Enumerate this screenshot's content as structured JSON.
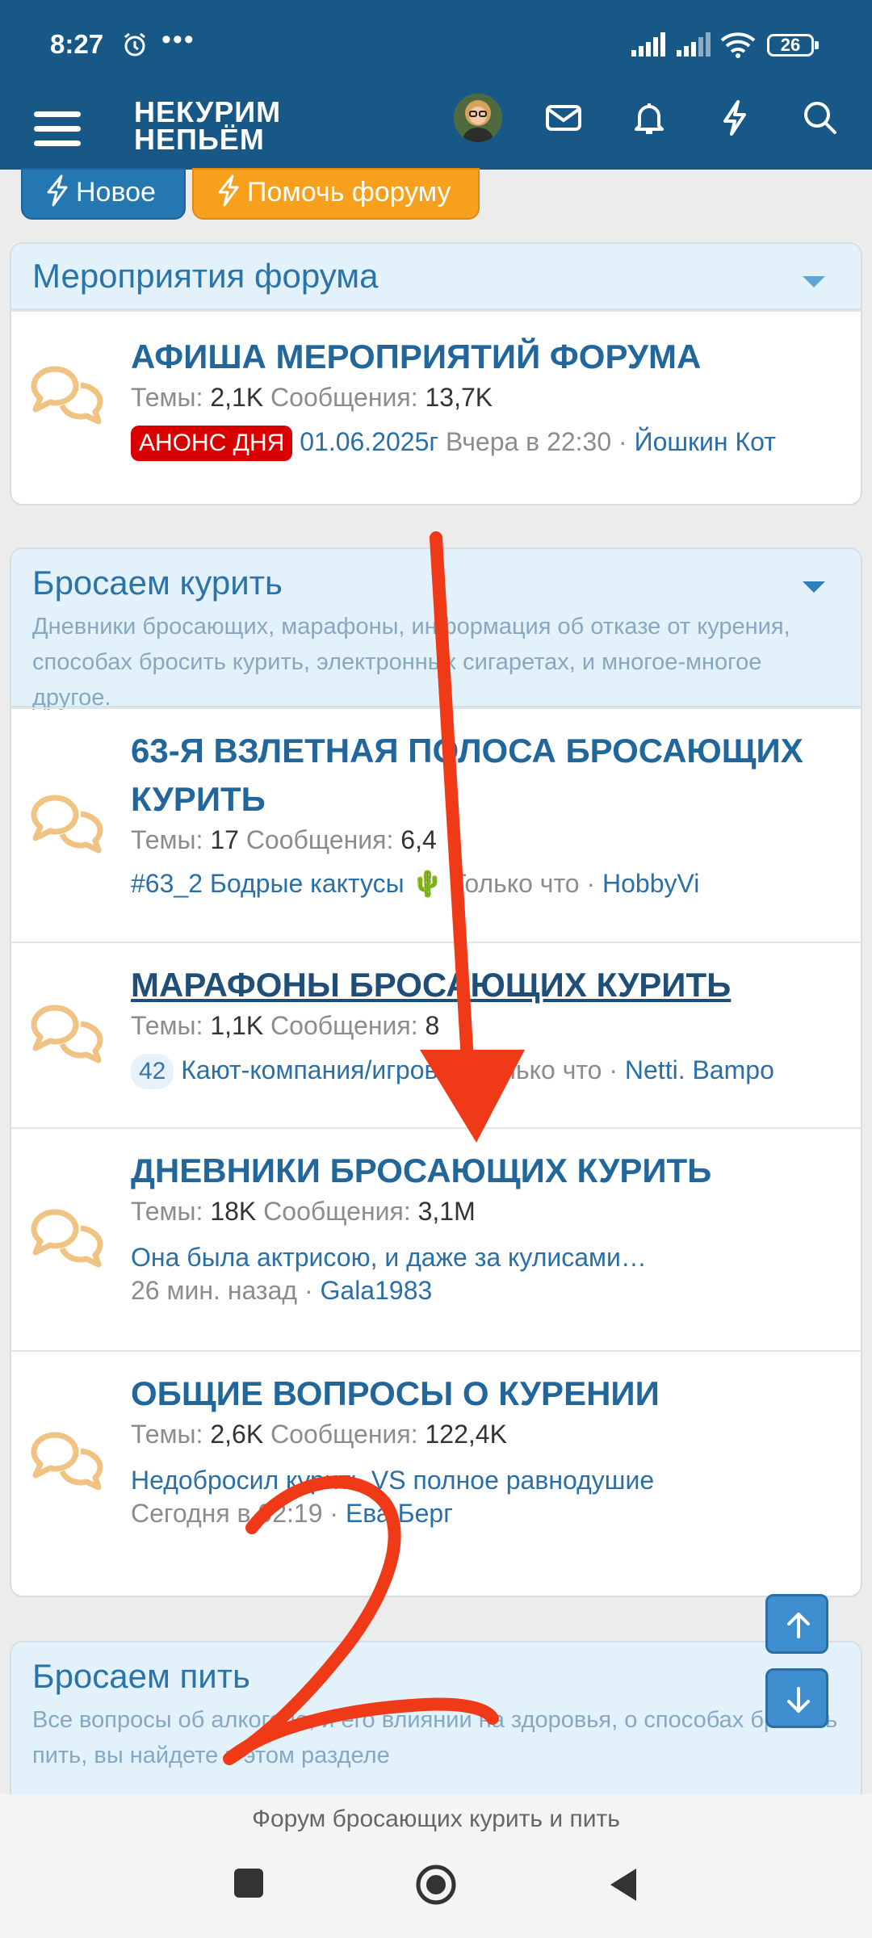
{
  "status": {
    "time": "8:27",
    "battery": "26"
  },
  "nav": {
    "logo_line1": "НЕКУРИМ",
    "logo_line2": "НЕПЬЁМ"
  },
  "buttons": {
    "new": "Новое",
    "help": "Помочь форуму"
  },
  "sections": [
    {
      "title": "Мероприятия форума",
      "nodes": [
        {
          "title": "АФИША МЕРОПРИЯТИЙ ФОРУМА",
          "threads_label": "Темы:",
          "threads": "2,1K",
          "posts_label": "Сообщения:",
          "posts": "13,7K",
          "badge": "АНОНС ДНЯ",
          "last_thread": "01.06.2025г",
          "last_time": "Вчера в 22:30",
          "last_user": "Йошкин Кот"
        }
      ]
    },
    {
      "title": "Бросаем курить",
      "description": "Дневники бросающих, марафоны, информация об отказе от курения, способах бросить курить, электронных сигаретах, и многое-многое другое.",
      "nodes": [
        {
          "title": "63-Я ВЗЛЕТНАЯ ПОЛОСА БРОСАЮЩИХ КУРИТЬ",
          "threads_label": "Темы:",
          "threads": "17",
          "posts_label": "Сообщения:",
          "posts": "6,4",
          "last_thread": "#63_2 Бодрые кактусы 🌵",
          "last_time": "Только что",
          "last_user": "HobbyVi"
        },
        {
          "title": "МАРАФОНЫ БРОСАЮЩИХ КУРИТЬ",
          "threads_label": "Темы:",
          "threads": "1,1K",
          "posts_label": "Сообщения:",
          "posts": "8",
          "count": "42",
          "last_thread": "Кают-компания/игровая",
          "last_time": "Только что",
          "last_user": "Netti. Bampo"
        },
        {
          "title": "ДНЕВНИКИ БРОСАЮЩИХ КУРИТЬ",
          "threads_label": "Темы:",
          "threads": "18K",
          "posts_label": "Сообщения:",
          "posts": "3,1M",
          "last_thread": "Она была актрисою, и даже за кулисами…",
          "last_time": "26 мин. назад",
          "last_user": "Gala1983"
        },
        {
          "title": "ОБЩИЕ ВОПРОСЫ О КУРЕНИИ",
          "threads_label": "Темы:",
          "threads": "2,6K",
          "posts_label": "Сообщения:",
          "posts": "122,4K",
          "last_thread": "Недобросил курить VS полное равнодушие",
          "last_time": "Сегодня в 02:19",
          "last_user": "Ева Берг"
        }
      ]
    },
    {
      "title": "Бросаем пить",
      "description": "Все вопросы об алкоголе, и его влиянии на здоровья, о способах бросить пить, вы найдете в этом разделе"
    }
  ],
  "footer": {
    "text": "Форум бросающих курить и пить"
  },
  "annotation": {
    "handwritten_digit": "2"
  },
  "colors": {
    "header": "#185886",
    "accent_orange": "#f7a01d",
    "link": "#2a6fa8",
    "badge_red": "#d80000",
    "annotation_red": "#f03a17"
  }
}
